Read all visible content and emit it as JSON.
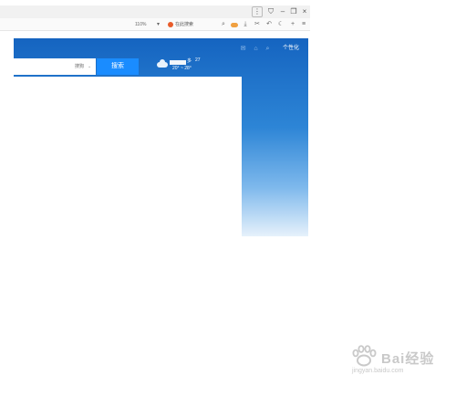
{
  "browser": {
    "zoom_level": "110%",
    "zoom_chevron": "▾",
    "search_hint": "在此搜索",
    "window_buttons": {
      "menu": "⋮",
      "shield": "⛉",
      "minimize": "–",
      "restore": "❐",
      "close": "×"
    },
    "toolbar_icons": {
      "search": "⌕",
      "download": "⤓",
      "cut": "✂",
      "undo": "↶",
      "night": "☾",
      "add": "+",
      "menu": "≡"
    }
  },
  "page": {
    "engine_label": "搜狗",
    "engine_arrow": "⌄",
    "search_button": "搜索",
    "weather": {
      "condition": "多",
      "aqi": "27",
      "temperature": "20° ~ 28°"
    },
    "header_icons": {
      "mail": "✉",
      "skin": "⌂",
      "search": "⌕"
    },
    "personalize": "个性化"
  },
  "watermark": {
    "brand": "Bai经验",
    "url": "jingyan.baidu.com"
  },
  "colors": {
    "page_blue": "#1564c0",
    "search_button": "#1a8cff",
    "browser_chrome": "#f1f1f1"
  }
}
